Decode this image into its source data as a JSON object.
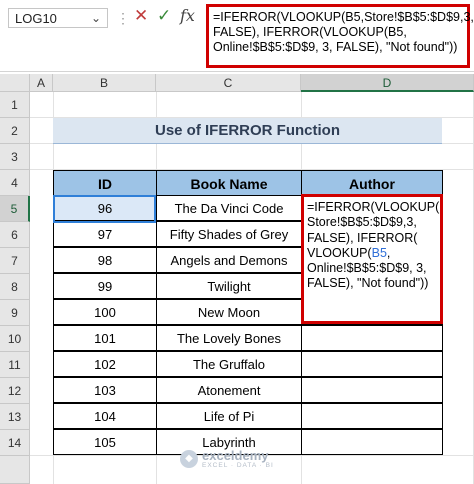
{
  "formula_bar": {
    "name_box": "LOG10",
    "fx_label": "fx",
    "formula": "=IFERROR(VLOOKUP(B5,Store!$B$5:$D$9,3,\nFALSE), IFERROR(VLOOKUP(B5,\nOnline!$B$5:$D$9, 3, FALSE), \"Not found\"))"
  },
  "columns": [
    "A",
    "B",
    "C",
    "D"
  ],
  "rows": [
    "1",
    "2",
    "3",
    "4",
    "5",
    "6",
    "7",
    "8",
    "9",
    "10",
    "11",
    "12",
    "13",
    "14"
  ],
  "title": "Use of IFERROR Function",
  "table": {
    "headers": [
      "ID",
      "Book Name",
      "Author"
    ],
    "rows": [
      {
        "id": "96",
        "book": "The Da Vinci Code"
      },
      {
        "id": "97",
        "book": "Fifty Shades of Grey"
      },
      {
        "id": "98",
        "book": "Angels and Demons"
      },
      {
        "id": "99",
        "book": "Twilight"
      },
      {
        "id": "100",
        "book": "New Moon"
      },
      {
        "id": "101",
        "book": "The Lovely Bones"
      },
      {
        "id": "102",
        "book": "The Gruffalo"
      },
      {
        "id": "103",
        "book": "Atonement"
      },
      {
        "id": "104",
        "book": "Life of Pi"
      },
      {
        "id": "105",
        "book": "Labyrinth"
      }
    ]
  },
  "cell_d5": {
    "p1": "=IFERROR(VLOOKUP(",
    "ref1": "B5",
    "p2": ",\nStore!$B$5:$D$9,3,\nFALSE), IFERROR(\nVLOOKUP(",
    "ref2": "B5",
    "p3": ",\nOnline!$B$5:$D$9, 3,\nFALSE), \"Not found\"))"
  },
  "watermark": {
    "name": "exceldemy",
    "tagline": "EXCEL · DATA · BI"
  },
  "colors": {
    "header_fill": "#9dc3e6",
    "title_fill": "#dce6f1",
    "highlight_border": "#d00000",
    "selection": "#217346"
  }
}
